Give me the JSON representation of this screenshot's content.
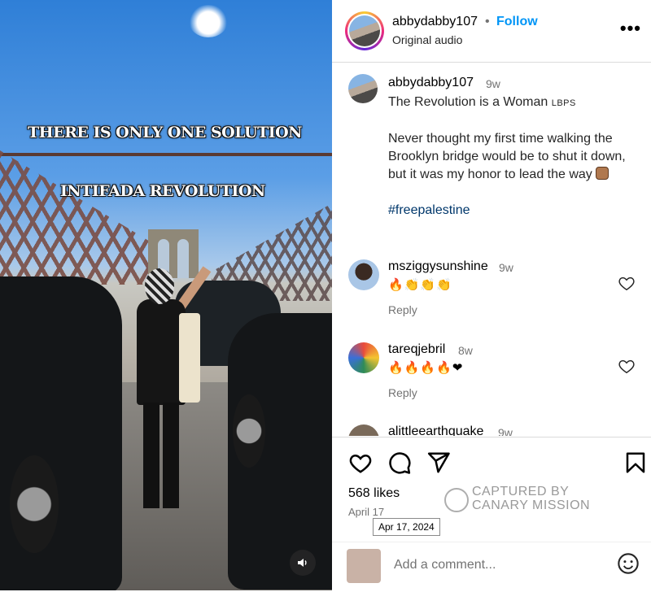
{
  "video": {
    "overlay_line1": "THERE IS ONLY ONE SOLUTION",
    "overlay_line2": "INTIFADA REVOLUTION",
    "audio_icon": "speaker-icon"
  },
  "header": {
    "username": "abbydabby107",
    "separator": "•",
    "follow_label": "Follow",
    "audio_label": "Original audio",
    "more_icon": "more-options-icon",
    "more_label": "•••"
  },
  "caption": {
    "username": "abbydabby107",
    "time": "9w",
    "title_text": "The Revolution is a Woman",
    "title_small": "LBPS",
    "body": "Never thought my first time walking the Brooklyn bridge would be to shut it down, but it was my honor to lead the way",
    "emoji_icon": "raised-fist-icon",
    "hashtag": "#freepalestine"
  },
  "comments": [
    {
      "username": "msziggysunshine",
      "time": "9w",
      "text": "🔥👏👏👏",
      "reply_label": "Reply",
      "avatar_color": "#6b4a3a"
    },
    {
      "username": "tareqjebril",
      "time": "8w",
      "text": "🔥🔥🔥🔥❤",
      "reply_label": "Reply",
      "avatar_color": "#d64a3a"
    },
    {
      "username": "alittleearthquake",
      "time": "9w",
      "text": "",
      "reply_label": "",
      "avatar_color": "#7a6a5a"
    }
  ],
  "actions": {
    "icons": [
      "heart-icon",
      "comment-icon",
      "share-icon",
      "bookmark-icon"
    ],
    "likes": "568 likes",
    "date": "April 17",
    "date_tooltip": "Apr 17, 2024"
  },
  "watermark": {
    "line1": "CAPTURED BY",
    "line2": "CANARY MISSION"
  },
  "add_comment": {
    "placeholder": "Add a comment..."
  },
  "colors": {
    "follow": "#0095f6",
    "muted": "#737373",
    "hashtag": "#00376b"
  }
}
